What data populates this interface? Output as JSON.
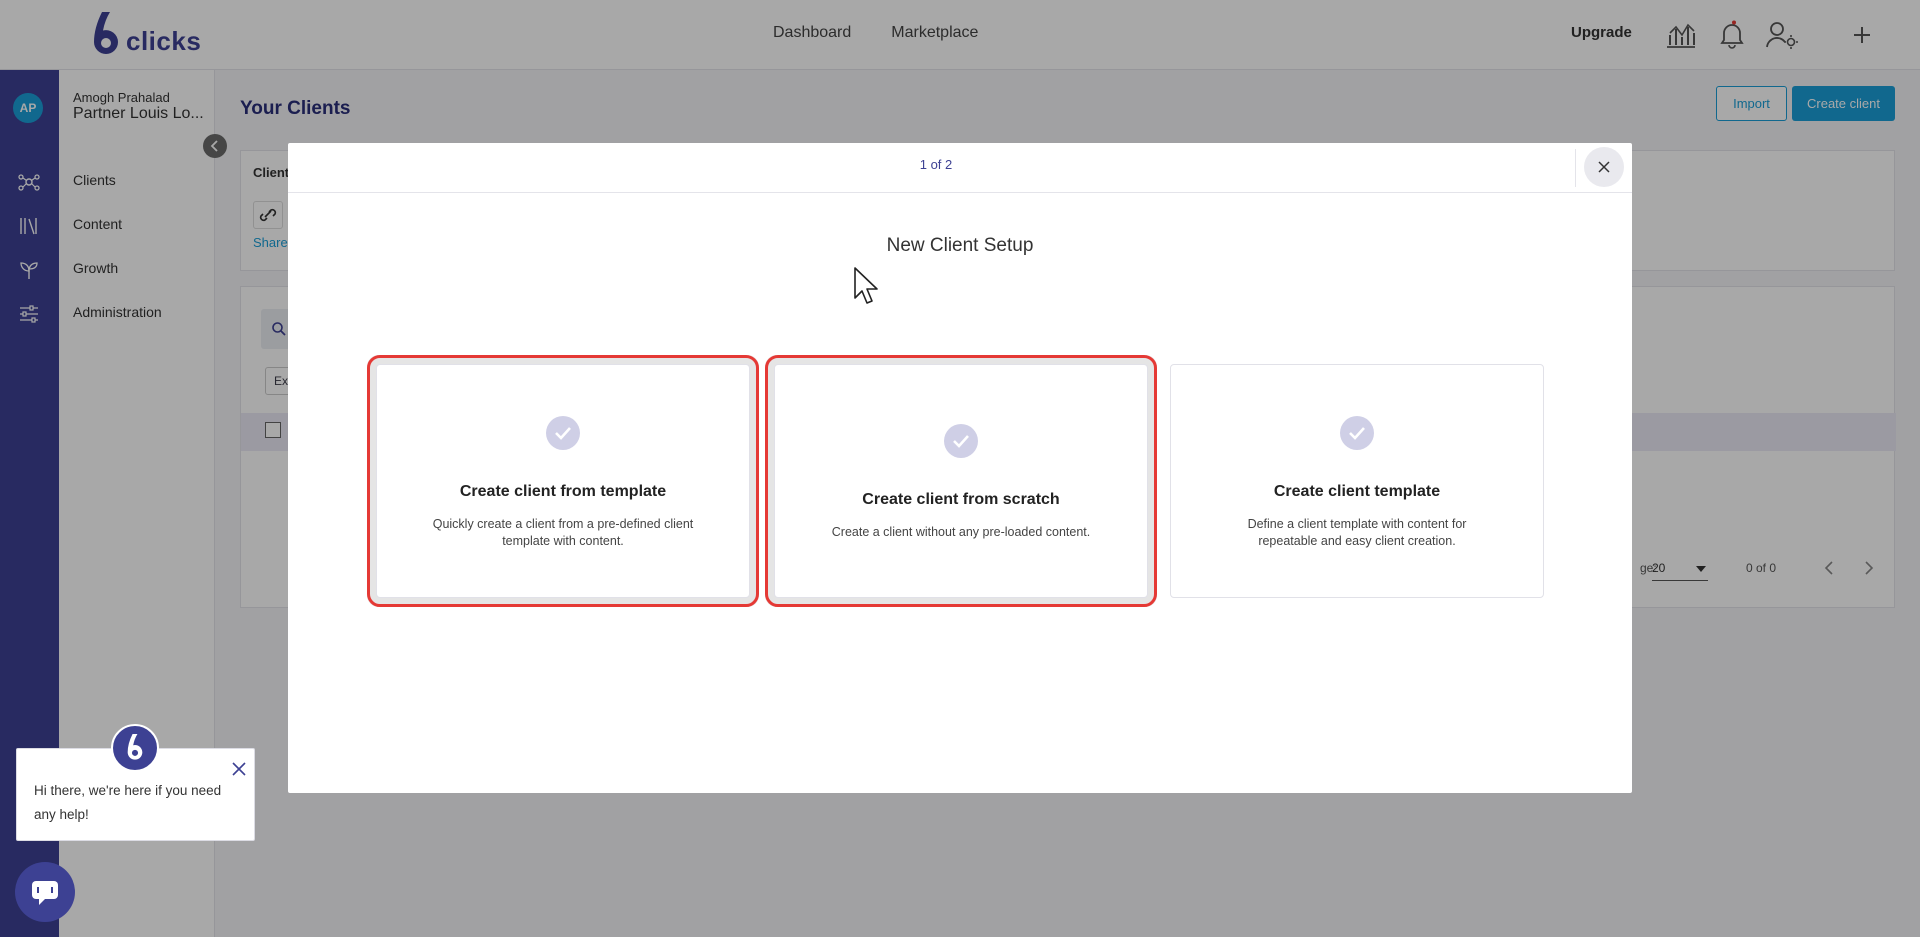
{
  "header": {
    "logo_text": "clicks",
    "nav": [
      "Dashboard",
      "Marketplace"
    ],
    "upgrade_label": "Upgrade",
    "icons": [
      "analytics-icon",
      "bell-icon",
      "user-settings-icon",
      "plus-icon"
    ]
  },
  "rail": {
    "avatar_initials": "AP",
    "icons": [
      "network-icon",
      "library-icon",
      "sprout-icon",
      "sliders-icon"
    ]
  },
  "sidenav": {
    "user_name": "Amogh Prahalad",
    "org_name": "Partner Louis Lo...",
    "items": [
      "Clients",
      "Content",
      "Growth",
      "Administration"
    ]
  },
  "main": {
    "title": "Your Clients",
    "import_label": "Import",
    "create_label": "Create client",
    "card_label": "Client",
    "share_label": "Share",
    "ex_label": "Ex",
    "pager_label": "ge:",
    "page_size": "20",
    "page_count": "0 of 0"
  },
  "modal": {
    "step": "1 of 2",
    "title": "New Client Setup",
    "options": [
      {
        "title": "Create client from template",
        "desc": "Quickly create a client from a pre-defined client template with content."
      },
      {
        "title": "Create client from scratch",
        "desc": "Create a client without any pre-loaded content."
      },
      {
        "title": "Create client template",
        "desc": "Define a client template with content for repeatable and easy client creation."
      }
    ]
  },
  "chat": {
    "message": "Hi there, we're here if you need any help!"
  },
  "colors": {
    "brand": "#3d4193",
    "accent": "#1a9fd8",
    "highlight": "#e53935"
  }
}
